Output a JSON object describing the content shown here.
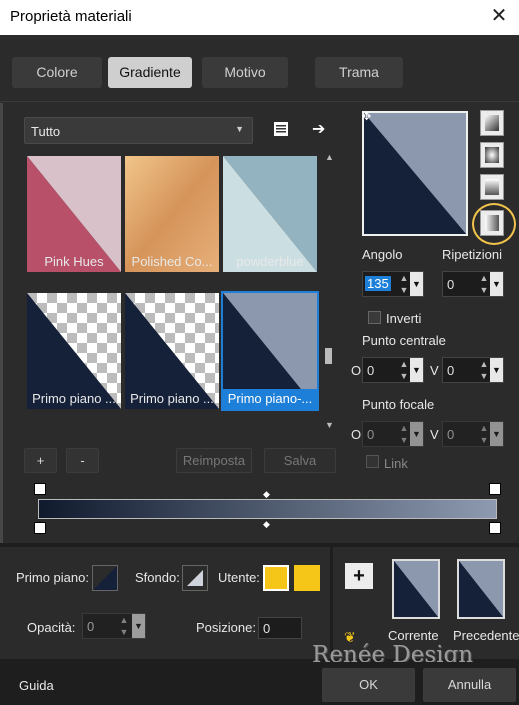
{
  "window": {
    "title": "Proprietà materiali",
    "close_glyph": "✕"
  },
  "tabs": [
    {
      "label": "Colore"
    },
    {
      "label": "Gradiente"
    },
    {
      "label": "Motivo"
    },
    {
      "label": "Trama"
    }
  ],
  "library": {
    "category": "Tutto",
    "items": [
      {
        "label": "Pink Hues"
      },
      {
        "label": "Polished Co..."
      },
      {
        "label": "powderblue"
      },
      {
        "label": "Primo piano ..."
      },
      {
        "label": "Primo piano ..."
      },
      {
        "label": "Primo piano-..."
      }
    ],
    "add_label": "+",
    "remove_label": "-",
    "reset_label": "Reimposta",
    "save_label": "Salva"
  },
  "gradient": {
    "angle_label": "Angolo",
    "angle_value": "135",
    "repeats_label": "Ripetizioni",
    "repeats_value": "0",
    "invert_label": "Inverti",
    "center_label": "Punto centrale",
    "center_o": "0",
    "center_v": "0",
    "focal_label": "Punto focale",
    "focal_o": "0",
    "focal_v": "0",
    "link_label": "Link",
    "o_label": "O",
    "v_label": "V",
    "colors": {
      "dark": "#0f1a2d",
      "light": "#8e9ab0"
    }
  },
  "bottom": {
    "foreground_label": "Primo piano:",
    "background_label": "Sfondo:",
    "user_label": "Utente:",
    "user_color": "#f5c518",
    "opacity_label": "Opacità:",
    "opacity_value": "0",
    "position_label": "Posizione:",
    "position_value": "0",
    "current_label": "Corrente",
    "previous_label": "Precedente",
    "plus_label": "+",
    "watermark": "Renée Design"
  },
  "footer": {
    "help_label": "Guida",
    "ok_label": "OK",
    "cancel_label": "Annulla"
  }
}
